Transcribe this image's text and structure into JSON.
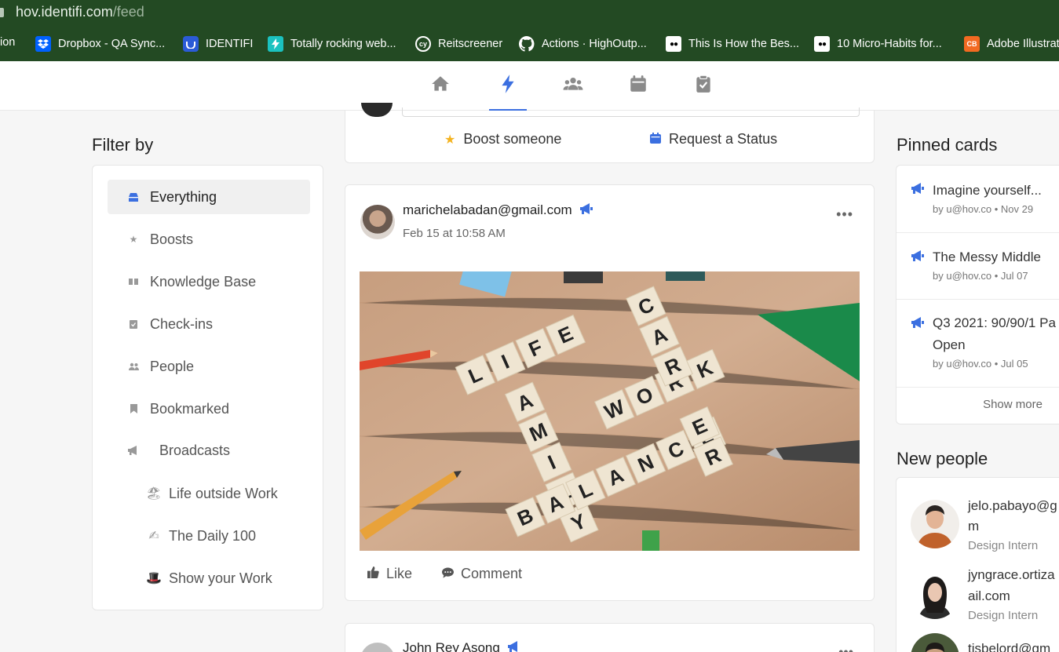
{
  "browser": {
    "url_host": "hov.identifi.com",
    "url_path": "/feed",
    "bookmarks": [
      {
        "label": "ion",
        "icon": "none"
      },
      {
        "label": "Dropbox - QA Sync...",
        "icon": "dropbox-icon",
        "color": "#0061fe"
      },
      {
        "label": "IDENTIFI",
        "icon": "identifi-icon",
        "color": "#2b5bd7"
      },
      {
        "label": "Totally rocking web...",
        "icon": "bolt-icon",
        "color": "#1bc2c0"
      },
      {
        "label": "Reitscreener",
        "icon": "reit-icon",
        "color": "#234a23"
      },
      {
        "label": "Actions · HighOutp...",
        "icon": "github-icon",
        "color": "#000000"
      },
      {
        "label": "This Is How the Bes...",
        "icon": "medium-icon",
        "color": "#000000"
      },
      {
        "label": "10 Micro-Habits for...",
        "icon": "medium-icon",
        "color": "#000000"
      },
      {
        "label": "Adobe Illustrat",
        "icon": "cb-icon",
        "color": "#f26a21"
      }
    ]
  },
  "nav": {
    "tabs": [
      "home",
      "feed",
      "people",
      "calendar",
      "checkins"
    ],
    "active": "feed",
    "accent": "#3b6fe0"
  },
  "filter": {
    "title": "Filter by",
    "items": [
      {
        "label": "Everything",
        "icon": "inbox-icon",
        "active": true
      },
      {
        "label": "Boosts",
        "icon": "star-icon"
      },
      {
        "label": "Knowledge Base",
        "icon": "book-icon"
      },
      {
        "label": "Check-ins",
        "icon": "clipboard-icon"
      },
      {
        "label": "People",
        "icon": "people-icon"
      },
      {
        "label": "Bookmarked",
        "icon": "bookmark-icon"
      },
      {
        "label": "Broadcasts",
        "icon": "megaphone-icon"
      },
      {
        "label": "Life outside Work",
        "icon": "🏖",
        "sub": true
      },
      {
        "label": "The Daily 100",
        "icon": "✍",
        "sub": true
      },
      {
        "label": "Show your Work",
        "icon": "🎩",
        "sub": true
      }
    ]
  },
  "compose": {
    "boost_label": "Boost someone",
    "status_label": "Request a Status"
  },
  "post": {
    "author": "marichelabadan@gmail.com",
    "date": "Feb 15 at 10:58 AM",
    "image_words": [
      "LIFE",
      "FAMILY",
      "WORK",
      "CAREER",
      "BALANCE"
    ],
    "like_label": "Like",
    "comment_label": "Comment"
  },
  "post2": {
    "author": "John Rey Asong"
  },
  "pinned": {
    "title": "Pinned cards",
    "cards": [
      {
        "title": "Imagine yourself...",
        "meta": "by u@hov.co • Nov 29"
      },
      {
        "title": "The Messy Middle",
        "meta": "by u@hov.co • Jul 07"
      },
      {
        "title": "Q3 2021: 90/90/1 Pa",
        "title2": "Open",
        "meta": "by u@hov.co • Jul 05"
      }
    ],
    "show_more": "Show more"
  },
  "new_people": {
    "title": "New people",
    "people": [
      {
        "name": "jelo.pabayo@g",
        "name2": "m",
        "role": "Design Intern"
      },
      {
        "name": "jyngrace.ortiza",
        "name2": "ail.com",
        "role": "Design Intern"
      },
      {
        "name": "tisbelord@gm",
        "name2": "",
        "role": ""
      }
    ]
  }
}
